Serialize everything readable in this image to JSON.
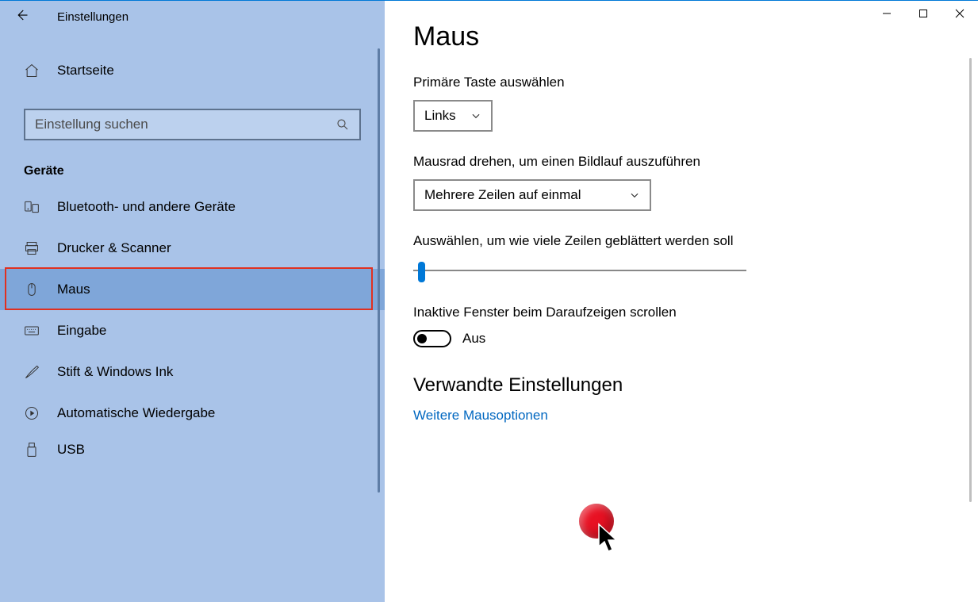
{
  "window": {
    "title": "Einstellungen"
  },
  "sidebar": {
    "home": "Startseite",
    "search_placeholder": "Einstellung suchen",
    "section": "Geräte",
    "items": [
      {
        "icon": "bluetooth",
        "label": "Bluetooth- und andere Geräte"
      },
      {
        "icon": "printer",
        "label": "Drucker & Scanner"
      },
      {
        "icon": "mouse",
        "label": "Maus",
        "selected": true
      },
      {
        "icon": "keyboard",
        "label": "Eingabe"
      },
      {
        "icon": "pen",
        "label": "Stift & Windows Ink"
      },
      {
        "icon": "autoplay",
        "label": "Automatische Wiedergabe"
      },
      {
        "icon": "usb",
        "label": "USB"
      }
    ]
  },
  "content": {
    "heading": "Maus",
    "primary_label": "Primäre Taste auswählen",
    "primary_value": "Links",
    "wheel_label": "Mausrad drehen, um einen Bildlauf auszuführen",
    "wheel_value": "Mehrere Zeilen auf einmal",
    "lines_label": "Auswählen, um wie viele Zeilen geblättert werden soll",
    "inactive_label": "Inaktive Fenster beim Daraufzeigen scrollen",
    "inactive_value": "Aus",
    "related_heading": "Verwandte Einstellungen",
    "related_link": "Weitere Mausoptionen"
  }
}
